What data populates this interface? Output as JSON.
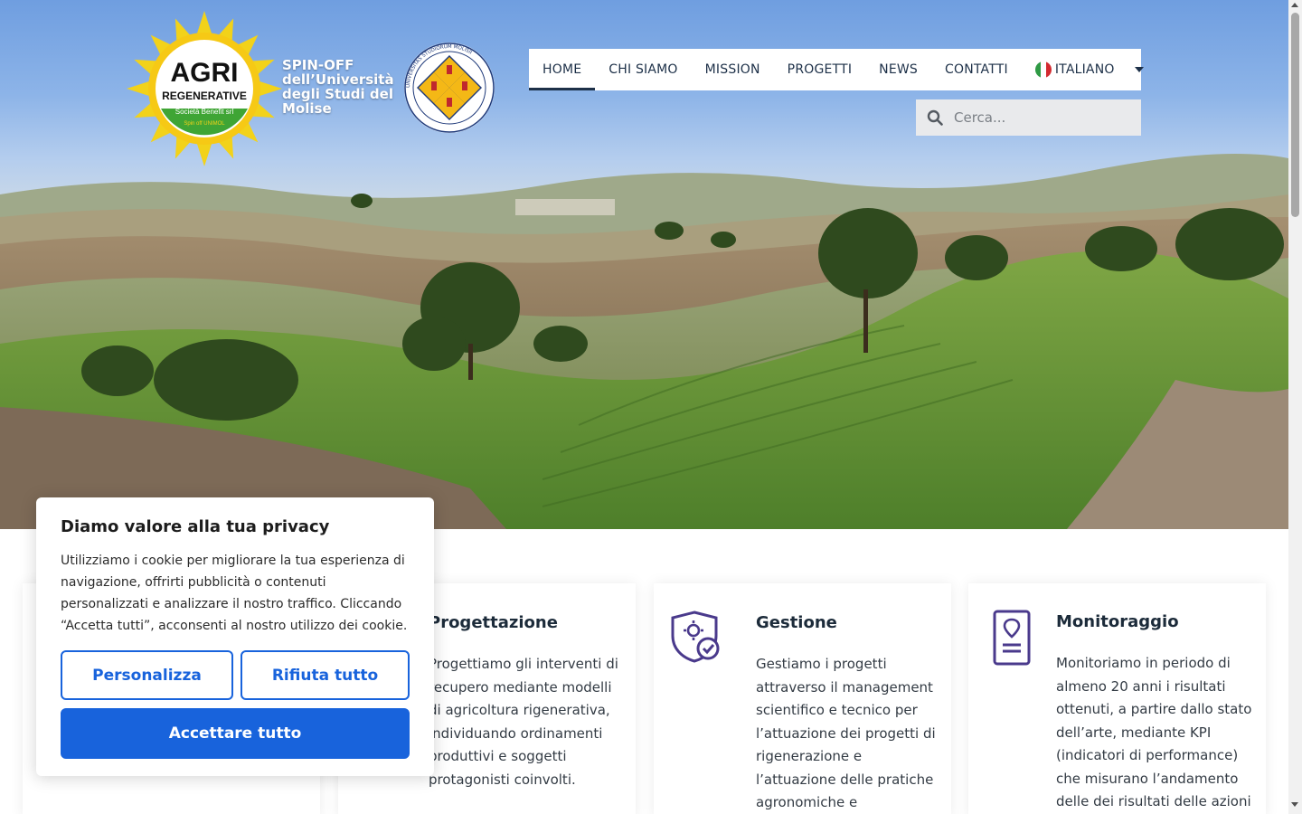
{
  "header": {
    "logo_text_line1": "AGRI",
    "logo_text_line2": "REGENERATIVE",
    "logo_text_line3": "Società Benefit srl",
    "logo_text_line4": "Spin off UNIMOL",
    "spinoff_text": "SPIN-OFF dell’Università degli Studi del Molise",
    "seal_text": "UNIVERSITAS STUDIORUM MOLISII"
  },
  "nav": {
    "items": [
      {
        "label": "HOME"
      },
      {
        "label": "CHI SIAMO"
      },
      {
        "label": "MISSION"
      },
      {
        "label": "PROGETTI"
      },
      {
        "label": "NEWS"
      },
      {
        "label": "CONTATTI"
      }
    ],
    "language": "ITALIANO"
  },
  "search": {
    "placeholder": "Cerca..."
  },
  "cards": [
    {
      "title": "Progettazione",
      "text": "Progettiamo gli interventi di recupero mediante modelli di agricoltura rigenerativa, individuando ordinamenti produttivi e soggetti protagonisti coinvolti.",
      "icon": "design-icon"
    },
    {
      "title": "Gestione",
      "text": "Gestiamo i progetti attraverso il management scientifico e tecnico per l’attuazione dei progetti di rigenerazione e l’attuazione delle pratiche agronomiche e",
      "icon": "shield-check-icon"
    },
    {
      "title": "Monitoraggio",
      "text": "Monitoriamo in periodo di almeno 20 anni i risultati ottenuti, a partire dallo stato dell’arte, mediante KPI (indicatori di performance) che misurano l’andamento delle dei risultati delle azioni",
      "icon": "report-pin-icon"
    }
  ],
  "cookie": {
    "title": "Diamo valore alla tua privacy",
    "text": "Utilizziamo i cookie per migliorare la tua esperienza di navigazione, offrirti pubblicità o contenuti personalizzati e analizzare il nostro traffico. Cliccando “Accetta tutti”, acconsenti al nostro utilizzo dei cookie.",
    "customize_label": "Personalizza",
    "reject_label": "Rifiuta tutto",
    "accept_label": "Accettare tutto"
  },
  "colors": {
    "accent": "#1863dc",
    "nav_text": "#1d3048",
    "icon_purple": "#4a3a8c"
  }
}
